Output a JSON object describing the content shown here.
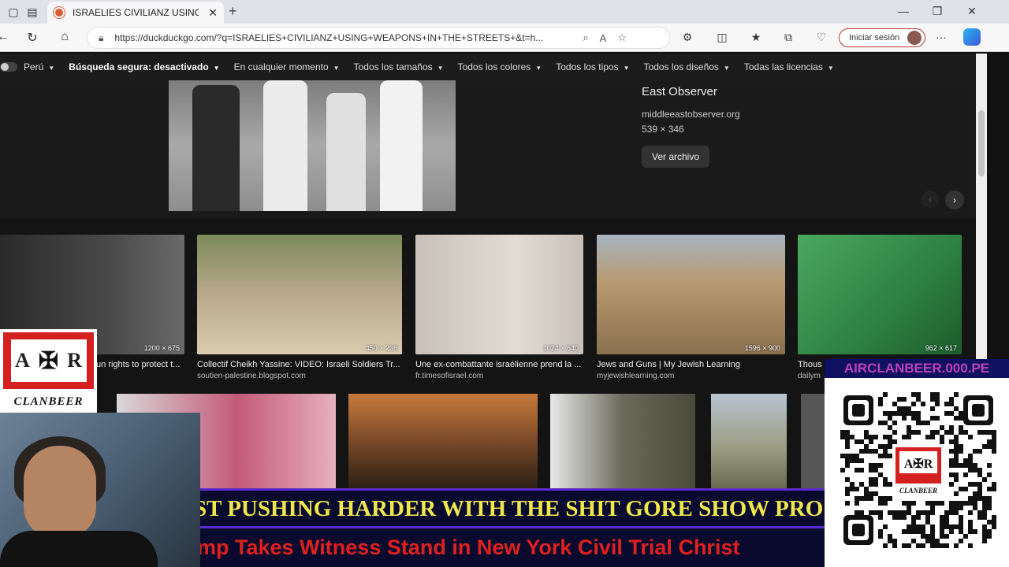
{
  "browser": {
    "tab_title": "ISRAELIES CIVILIANZ USING WEAPONS IN THE STREETS",
    "tab_close": "✕",
    "new_tab": "+",
    "url": "https://duckduckgo.com/?q=ISRAELIES+CIVILIANZ+USING+WEAPONS+IN+THE+STREETS+&t=h...",
    "signin_label": "Iniciar sesión"
  },
  "filters": {
    "region": "Perú",
    "safe_search": "Búsqueda segura: desactivado",
    "time": "En cualquier momento",
    "size": "Todos los tamaños",
    "color": "Todos los colores",
    "type": "Todos los tipos",
    "layout": "Todos los diseños",
    "license": "Todas las licencias"
  },
  "detail": {
    "title": "East Observer",
    "site": "middleeastobserver.org",
    "size": "539 × 346",
    "view_button": "Ver archivo"
  },
  "results": [
    {
      "dim": "1200 × 675",
      "caption": "un rights to protect t...",
      "source": ""
    },
    {
      "dim": "450 × 236",
      "caption": "Collectif Cheikh Yassine: VIDEO: Israeli Soldiers Tr...",
      "source": "soutien-palestine.blogspot.com"
    },
    {
      "dim": "1024 × 640",
      "caption": "Une ex-combattante israélienne prend la ...",
      "source": "fr.timesofisrael.com"
    },
    {
      "dim": "1596 × 900",
      "caption": "Jews and Guns | My Jewish Learning",
      "source": "myjewishlearning.com"
    },
    {
      "dim": "962 × 617",
      "caption": "Thous",
      "source": "dailym"
    }
  ],
  "overlay": {
    "logo_left": "A",
    "logo_right": "R",
    "logo_caption": "CLANBEER",
    "ticker_top": "ST PUSHING HARDER WITH THE SHIT GORE SHOW PRO",
    "ticker_bottom": "mp Takes Witness Stand in New York Civil Trial Christ",
    "qr_url": "AIRCLANBEER.000.PE",
    "qr_caption": "CLANBEER"
  }
}
